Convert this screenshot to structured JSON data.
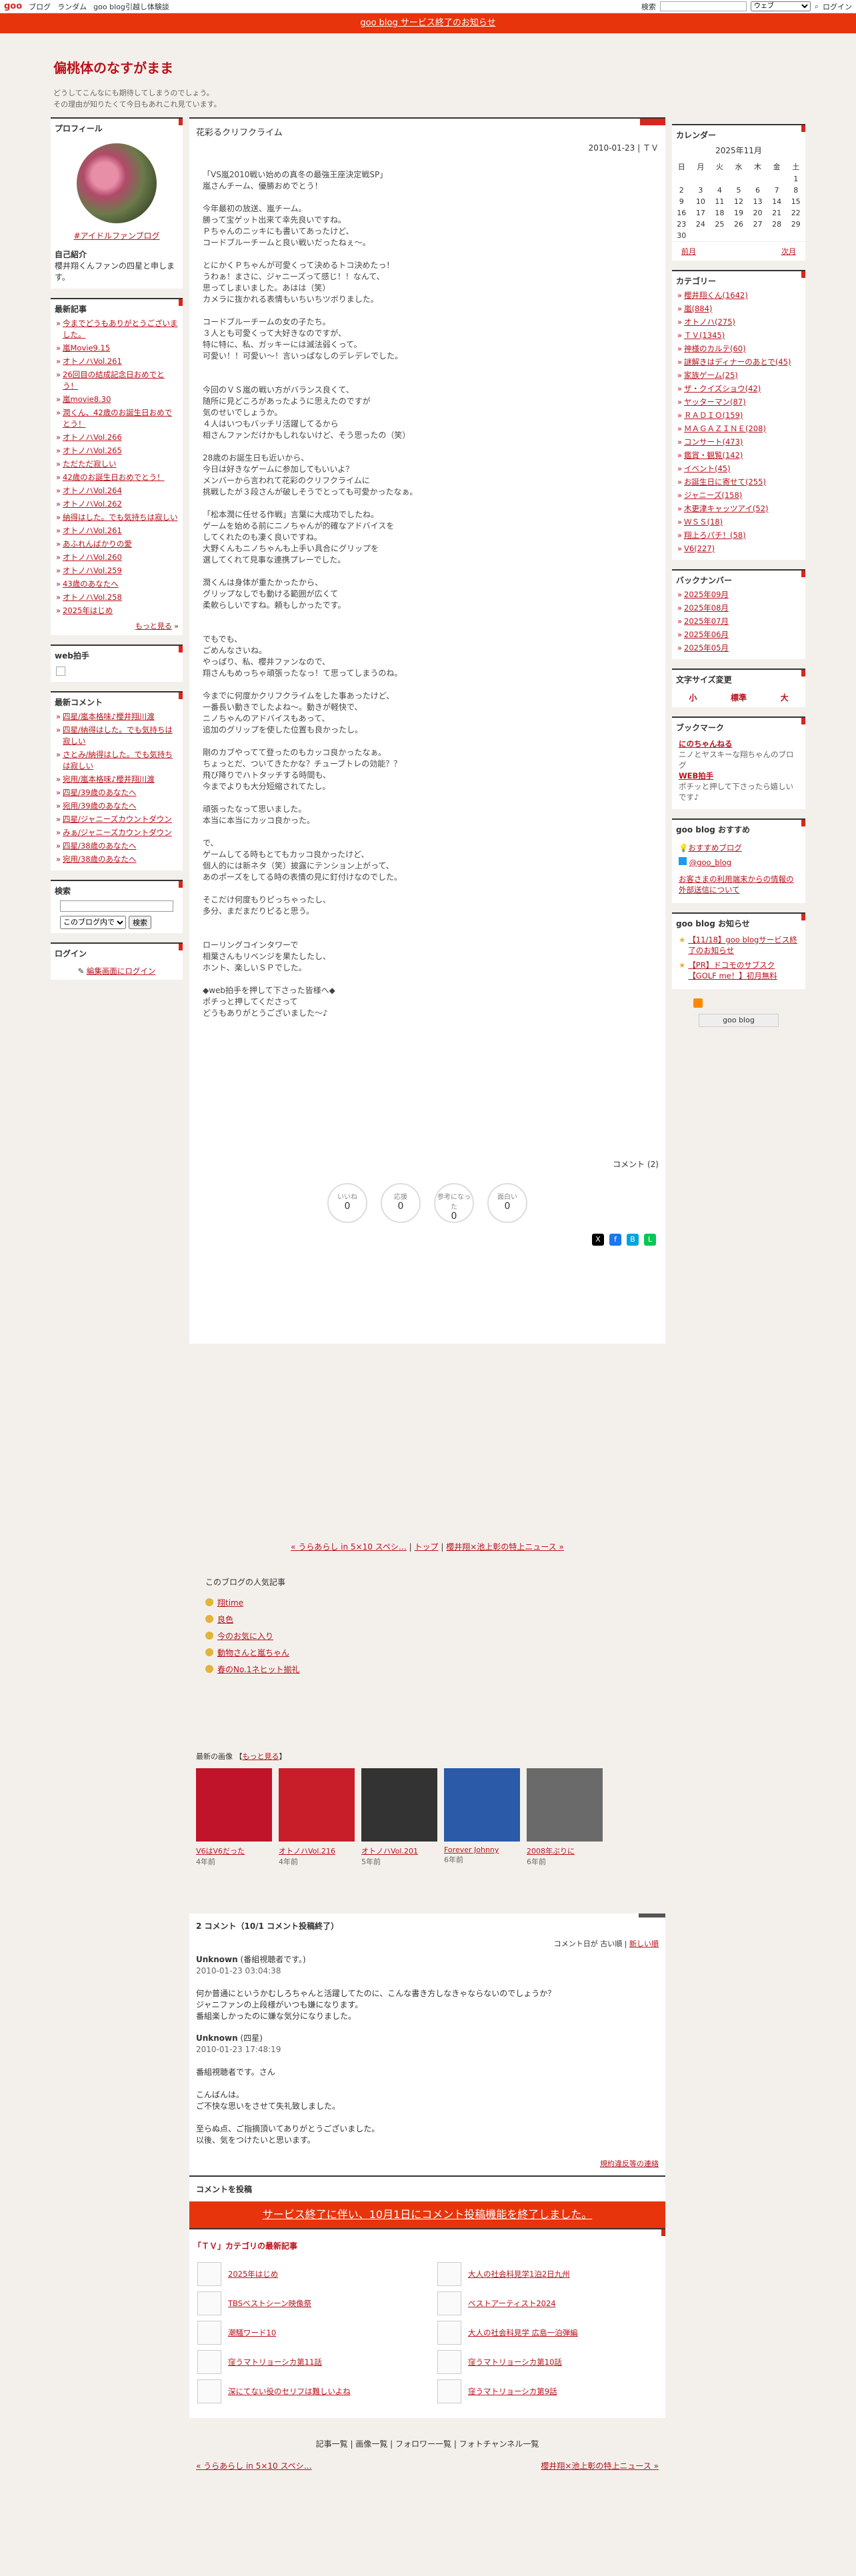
{
  "topbar": {
    "logo": "goo",
    "nav": [
      "ブログ",
      "ランダム",
      "goo blog引越し体験談"
    ],
    "search_label": "検索",
    "scope": "ウェブ",
    "login": "ログイン"
  },
  "notice": {
    "text": "goo blog サービス終了のお知らせ"
  },
  "blog": {
    "title": "偏桃体のなすがまま",
    "desc1": "どうしてこんなにも期待してしまうのでしょう。",
    "desc2": "その理由が知りたくて今日もあれこれ見ています。"
  },
  "profile": {
    "title": "プロフィール",
    "fan": "#アイドルファンブログ",
    "intro_title": "自己紹介",
    "intro": "櫻井翔くんファンの四星と申します。"
  },
  "recent": {
    "title": "最新記事",
    "items": [
      "今までどうもありがとうございました。",
      "嵐Movie9.15",
      "オトノハVol.261",
      "26回目の結成記念日おめでとう！",
      "嵐movie8.30",
      "潤くん、42歳のお誕生日おめでとう！",
      "オトノハVol.266",
      "オトノハVol.265",
      "ただただ寂しい",
      "42歳のお誕生日おめでとう！",
      "オトノハVol.264",
      "オトノハVol.262",
      "納得はした。でも気持ちは寂しい",
      "オトノハVol.261",
      "あふれんばかりの愛",
      "オトノハVol.260",
      "オトノハVol.259",
      "43歳のあなたへ",
      "オトノハVol.258",
      "2025年はじめ"
    ],
    "more": "もっと見る"
  },
  "webclap": {
    "title": "web拍手"
  },
  "comments": {
    "title": "最新コメント",
    "items": [
      "四星/嵐本格味♪櫻井翔川渡",
      "四星/納得はした。でも気持ちは寂しい",
      "さとみ/納得はした。でも気持ちは寂しい",
      "宛用/嵐本格味♪櫻井翔川渡",
      "四星/39歳のあなたへ",
      "宛用/39歳のあなたへ",
      "四星/ジャニーズカウントダウン",
      "みぁ/ジャニーズカウントダウン",
      "四星/38歳のあなたへ",
      "宛用/38歳のあなたへ"
    ]
  },
  "search": {
    "title": "検索",
    "scope": "このブログ内で",
    "button": "検索"
  },
  "login": {
    "title": "ログイン",
    "link": "編集画面にログイン"
  },
  "post": {
    "title": "花彩るクリフクライム",
    "date": "2010-01-23 | ＴＶ",
    "body": "「VS嵐2010戦い始めの真冬の最強王座決定戦SP」\n嵐さんチーム、優勝おめでとう！\n\n今年最初の放送、嵐チーム。\n勝って宝ゲット出来て幸先良いですね。\nＰちゃんのニッキにも書いてあったけど、\nコードブルーチームと良い戦いだったねぇ～。\n\nとにかくＰちゃんが可愛くって決めるトコ決めたっ！\nうわぁ！まさに、ジャニーズって感じ！！なんて、\n思ってしまいました。あはは（笑）\nカメラに抜かれる表情もいちいちツボりました。\n\nコードブルーチームの女の子たち。\n３人とも可愛くって大好きなのですが、\n特に特に、私、ガッキーには滅法弱くって。\n可愛い！！可愛い～！言いっぱなしのデレデレでした。\n\n\n今回のＶＳ嵐の戦い方がバランス良くて、\n随所に見どころがあったように思えたのですが\n気のせいでしょうか。\n４人はいつもバッチリ活躍してるから\n相さんファンだけかもしれないけど、そう思ったの（笑）\n\n28歳のお誕生日も近いから、\n今日は好きなゲームに参加してもいいよ？\nメンバーから言われて花彩のクリフクライムに\n挑戦したが３段さんが破しそうでとっても可愛かったなぁ。\n\n「松本潤に任せる作戦」言葉に大成功でしたね。\nゲームを始める前にニノちゃんが的確なアドバイスを\nしてくれたのも凄く良いですね。\n大野くんもニノちゃんも上手い具合にグリップを\n選してくれて見事な連携プレーでした。\n\n潤くんは身体が重たかったから、\nグリップなしでも動ける範囲が広くて\n柔軟らしいですね。頼もしかったです。\n\n\nでもでも、\nごめんなさいね。\nやっぱり、私、櫻井ファンなので、\n翔さんもめっちゃ頑張ったなっ！て思ってしまうのね。\n\n今までに何度かクリフクライムをした事あったけど、\n一番長い動きでしたよね～。動きが軽快で、\nニノちゃんのアドバイスもあって、\n追加のグリップを使した位置も良かったし。\n\n剛のカブやってて登ったのもカッコ良かったなぁ。\nちょっとだ、ついてきたかな？チューブトレの効能？？\n飛び降りでハトタッチする時間も、\n今までよりも大分短縮されてたし。\n\n頑張ったなって思いました。\n本当に本当にカッコ良かった。\n\nで、\nゲームしてる時もとてもカッコ良かったけど、\n個人的には新ネタ（笑）披露にテンション上がって、\nあのポーズをしてる時の表情の見に釘付けなのでした。\n\nそこだけ何度もりピっちゃったし、\n多分、まだまだりピると思う。\n\n\nローリングコインタワーで\n相葉さんもリベンジを果たしたし、\nホント、楽しいＳＰでした。\n\n◆web拍手を押して下さった皆様へ◆\nポチっと押してくださって\nどうもありがとうございました～♪",
    "comment_count": "コメント (2)",
    "reactions": [
      {
        "label": "いいね",
        "count": "0"
      },
      {
        "label": "応援",
        "count": "0"
      },
      {
        "label": "参考になった",
        "count": "0"
      },
      {
        "label": "面白い",
        "count": "0"
      }
    ]
  },
  "calendar": {
    "title": "カレンダー",
    "month": "2025年11月",
    "days": [
      "日",
      "月",
      "火",
      "水",
      "木",
      "金",
      "土"
    ],
    "prev": "前月",
    "next": "次月"
  },
  "category": {
    "title": "カテゴリー",
    "items": [
      "櫻井翔くん(1642)",
      "嵐(884)",
      "オトノハ(275)",
      "ＴＶ(1345)",
      "神様のカルテ(60)",
      "謎解きはディナーのあとで(45)",
      "家族ゲーム(25)",
      "ザ・クイズショウ(42)",
      "ヤッターマン(87)",
      "ＲＡＤＩＯ(159)",
      "ＭＡＧＡＺＩＮＥ(208)",
      "コンサート(473)",
      "鑑賞・観覧(142)",
      "イベント(45)",
      "お誕生日に寄せて(255)",
      "ジャニーズ(158)",
      "木更津キャッツアイ(52)",
      "ＷＳＳ(18)",
      "翔上ろパチ！(58)",
      "V6(227)"
    ]
  },
  "backnumber": {
    "title": "バックナンバー",
    "items": [
      "2025年09月",
      "2025年08月",
      "2025年07月",
      "2025年06月",
      "2025年05月"
    ]
  },
  "fontsize": {
    "title": "文字サイズ変更",
    "s": "小",
    "m": "標準",
    "l": "大"
  },
  "bookmark": {
    "title": "ブックマーク",
    "b1": "にのちゃんねる",
    "b1d": "ニノとヤスキーな翔ちゃんのブログ",
    "b2": "WEB拍手",
    "b2d": "ポチッと押して下さったら嬉しいです♪"
  },
  "goo_rec": {
    "title": "goo blog おすすめ",
    "r1": "おすすめブログ",
    "r2": "@goo_blog",
    "r3": "お客さまの利用端末からの情報の外部送信について"
  },
  "goo_news": {
    "title": "goo blog お知らせ",
    "n1": "【11/18】goo blogサービス終了のお知らせ",
    "n2": "【PR】ドコモのサブスク【GOLF me！】初月無料"
  },
  "goo_logo": "goo blog",
  "pager": {
    "prev": "« うらあらし in 5×10 スペシ…",
    "top": "トップ",
    "next": "櫻井翔×池上彰の特上ニュース »"
  },
  "popular": {
    "title": "このブログの人気記事",
    "items": [
      "翔time",
      "良色",
      "今のお気に入り",
      "動物さんと嵐ちゃん",
      "春のNo.1ネヒット揃礼"
    ]
  },
  "images": {
    "title": "最新の画像",
    "more": "もっと見る",
    "items": [
      {
        "title": "V6はV6だった",
        "ago": "4年前"
      },
      {
        "title": "オトノハVol.216",
        "ago": "4年前"
      },
      {
        "title": "オトノハVol.201",
        "ago": "5年前"
      },
      {
        "title": "Forever Johnny",
        "ago": "6年前"
      },
      {
        "title": "2008年ぶりに",
        "ago": "6年前"
      }
    ]
  },
  "cmtsec": {
    "title": "2 コメント（10/1 コメント投稿終了）",
    "sort": "コメント日が",
    "old": "古い順",
    "new": "新しい順",
    "c1n": "Unknown",
    "c1r": "(番組視聴者です。)",
    "c1d": "2010-01-23 03:04:38",
    "c1t": "何か普通にというかむしろちゃんと活躍してたのに、こんな書き方しなきゃならないのでしょうか？\nジャニファンの上段様がいつも嫌になります。\n番組楽しかったのに嫌な気分になりました。",
    "c2n": "Unknown",
    "c2r": "(四星)",
    "c2d": "2010-01-23 17:48:19",
    "c2t": "番組視聴者です。さん\n\nこんばんは。\nご不快な思いをさせて失礼致しました。\n\n至らぬ点、ご指摘頂いてありがとうございました。\n以後、気をつけたいと思います。",
    "report": "規約違反等の連絡",
    "post_title": "コメントを投稿",
    "closed": "サービス終了に伴い、10月1日にコメント投稿機能を終了しました。"
  },
  "tvcat": {
    "title": "「ＴＶ」カテゴリの最新記事",
    "items": [
      "2025年はじめ",
      "大人の社会科見学1泊2日九州",
      "TBSベストシーン映像祭",
      "ベストアーティスト2024",
      "潮騒ワード10",
      "大人の社会科見学 広島一泊弾編",
      "窪うマトリョーシカ第11話",
      "窪うマトリョーシカ第10話",
      "深にてない役のセリフは難しいよね",
      "窪うマトリョーシカ第9話"
    ]
  },
  "footer": {
    "links": "記事一覧 | 画像一覧 | フォロワー一覧 | フォトチャンネル一覧",
    "prev": "« うらあらし in 5×10 スペシ…",
    "next": "櫻井翔×池上彰の特上ニュース »"
  }
}
